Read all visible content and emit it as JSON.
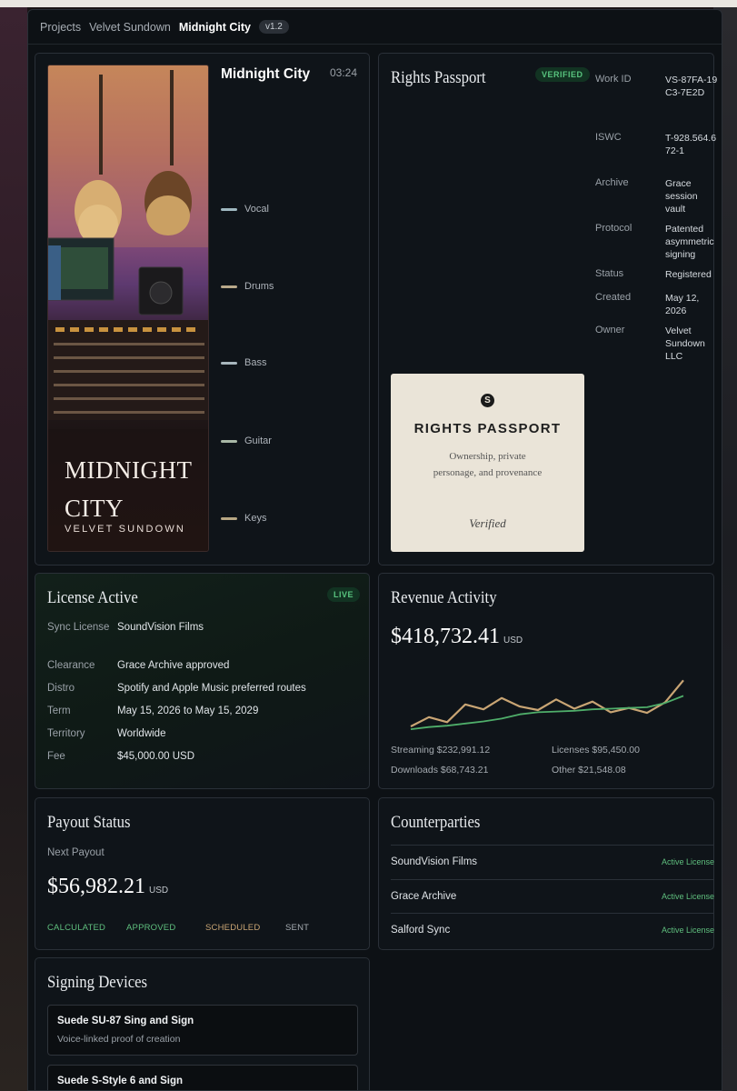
{
  "breadcrumb": {
    "items": [
      "Projects",
      "Velvet Sundown"
    ],
    "current": "Midnight City",
    "version": "v1.2"
  },
  "track": {
    "name": "Midnight City",
    "duration": "03:24",
    "art_title": "MIDNIGHT CITY",
    "art_artist": "VELVET SUNDOWN",
    "stems": [
      {
        "label": "Vocal",
        "color": "#9fb8c0"
      },
      {
        "label": "Drums",
        "color": "#b9a98a"
      },
      {
        "label": "Bass",
        "color": "#a8b7bd"
      },
      {
        "label": "Guitar",
        "color": "#a9b8a6"
      },
      {
        "label": "Keys",
        "color": "#b8a784"
      }
    ]
  },
  "rights": {
    "title": "Rights Passport",
    "badge": "VERIFIED",
    "rows": [
      {
        "key": "Work ID",
        "value": "VS-87FA-19C3-7E2D"
      },
      {
        "key": "ISWC",
        "value": "T-928.564.672-1"
      },
      {
        "key": "Archive",
        "value": "Grace session vault"
      },
      {
        "key": "Protocol",
        "value": "Patented asymmetric signing"
      },
      {
        "key": "Status",
        "value": "Registered"
      },
      {
        "key": "Created",
        "value": "May 12, 2026"
      },
      {
        "key": "Owner",
        "value": "Velvet Sundown LLC"
      }
    ],
    "passport": {
      "logo": "S",
      "title": "RIGHTS PASSPORT",
      "subtitle": "Ownership, private personage, and provenance",
      "verified": "Verified"
    }
  },
  "license": {
    "title": "License Active",
    "badge": "LIVE",
    "rows": [
      {
        "key": "Sync License",
        "value": "SoundVision Films"
      },
      {
        "key": "Clearance",
        "value": "Grace Archive approved"
      },
      {
        "key": "Distro",
        "value": "Spotify and Apple Music preferred routes"
      },
      {
        "key": "Term",
        "value": "May 15, 2026 to May 15, 2029"
      },
      {
        "key": "Territory",
        "value": "Worldwide"
      },
      {
        "key": "Fee",
        "value": "$45,000.00 USD"
      }
    ]
  },
  "revenue": {
    "title": "Revenue Activity",
    "amount": "$418,732.41",
    "currency": "USD",
    "stats": [
      {
        "label": "Streaming $232,991.12"
      },
      {
        "label": "Licenses $95,450.00"
      },
      {
        "label": "Downloads $68,743.21"
      },
      {
        "label": "Other $21,548.08"
      }
    ],
    "colors": {
      "tan": "#c9a574",
      "green": "#4fae6a"
    }
  },
  "chart_data": {
    "type": "line",
    "x": [
      0,
      1,
      2,
      3,
      4,
      5,
      6,
      7,
      8,
      9,
      10,
      11,
      12,
      13,
      14,
      15
    ],
    "series": [
      {
        "values": [
          0.36,
          0.62,
          0.48,
          0.98,
          0.84,
          1.16,
          0.92,
          0.82,
          1.12,
          0.86,
          1.06,
          0.76,
          0.88,
          0.74,
          1.04,
          1.66
        ]
      },
      {
        "values": [
          0.28,
          0.34,
          0.38,
          0.44,
          0.5,
          0.58,
          0.7,
          0.76,
          0.78,
          0.8,
          0.84,
          0.86,
          0.88,
          0.9,
          1.02,
          1.22
        ]
      }
    ]
  },
  "payout": {
    "title": "Payout Status",
    "label": "Next Payout",
    "amount": "$56,982.21",
    "currency": "USD",
    "stages": [
      {
        "label": "CALCULATED",
        "color": "#5fbf7e"
      },
      {
        "label": "APPROVED",
        "color": "#5fbf7e"
      },
      {
        "label": "SCHEDULED",
        "color": "#c9a574"
      },
      {
        "label": "SENT",
        "color": "#a5abb1"
      }
    ]
  },
  "counterparties": {
    "title": "Counterparties",
    "rows": [
      {
        "name": "SoundVision Films",
        "status": "Active License"
      },
      {
        "name": "Grace Archive",
        "status": "Active License"
      },
      {
        "name": "Salford Sync",
        "status": "Active License"
      }
    ]
  },
  "devices": {
    "title": "Signing Devices",
    "items": [
      {
        "name": "Suede SU-87 Sing and Sign",
        "sub": "Voice-linked proof of creation"
      },
      {
        "name": "Suede S-Style 6 and Sign",
        "sub": ""
      }
    ]
  }
}
